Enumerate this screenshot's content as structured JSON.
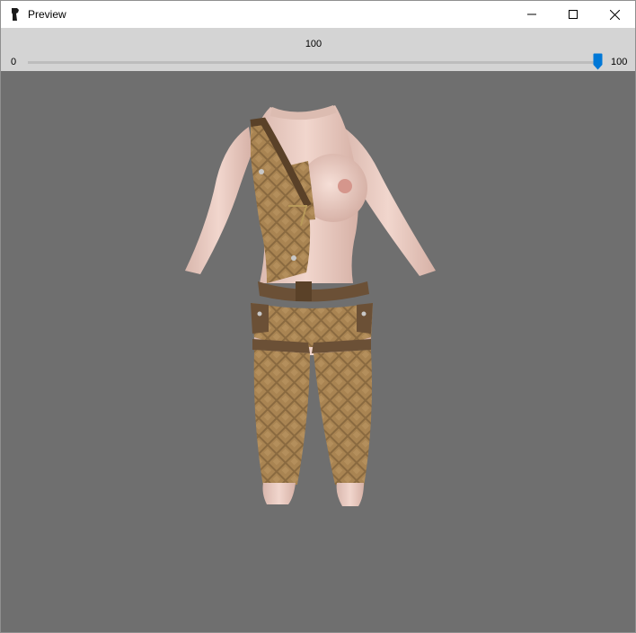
{
  "window": {
    "title": "Preview",
    "icon": "app-icon",
    "controls": [
      "minimize-icon",
      "maximize-icon",
      "close-icon"
    ]
  },
  "slider": {
    "value_label": "100",
    "min_label": "0",
    "max_label": "100",
    "value": 100,
    "min": 0,
    "max": 100,
    "accent_color": "#0078d7"
  },
  "viewport": {
    "background": "#6f6f6f",
    "content": "outfit-preview-model"
  }
}
